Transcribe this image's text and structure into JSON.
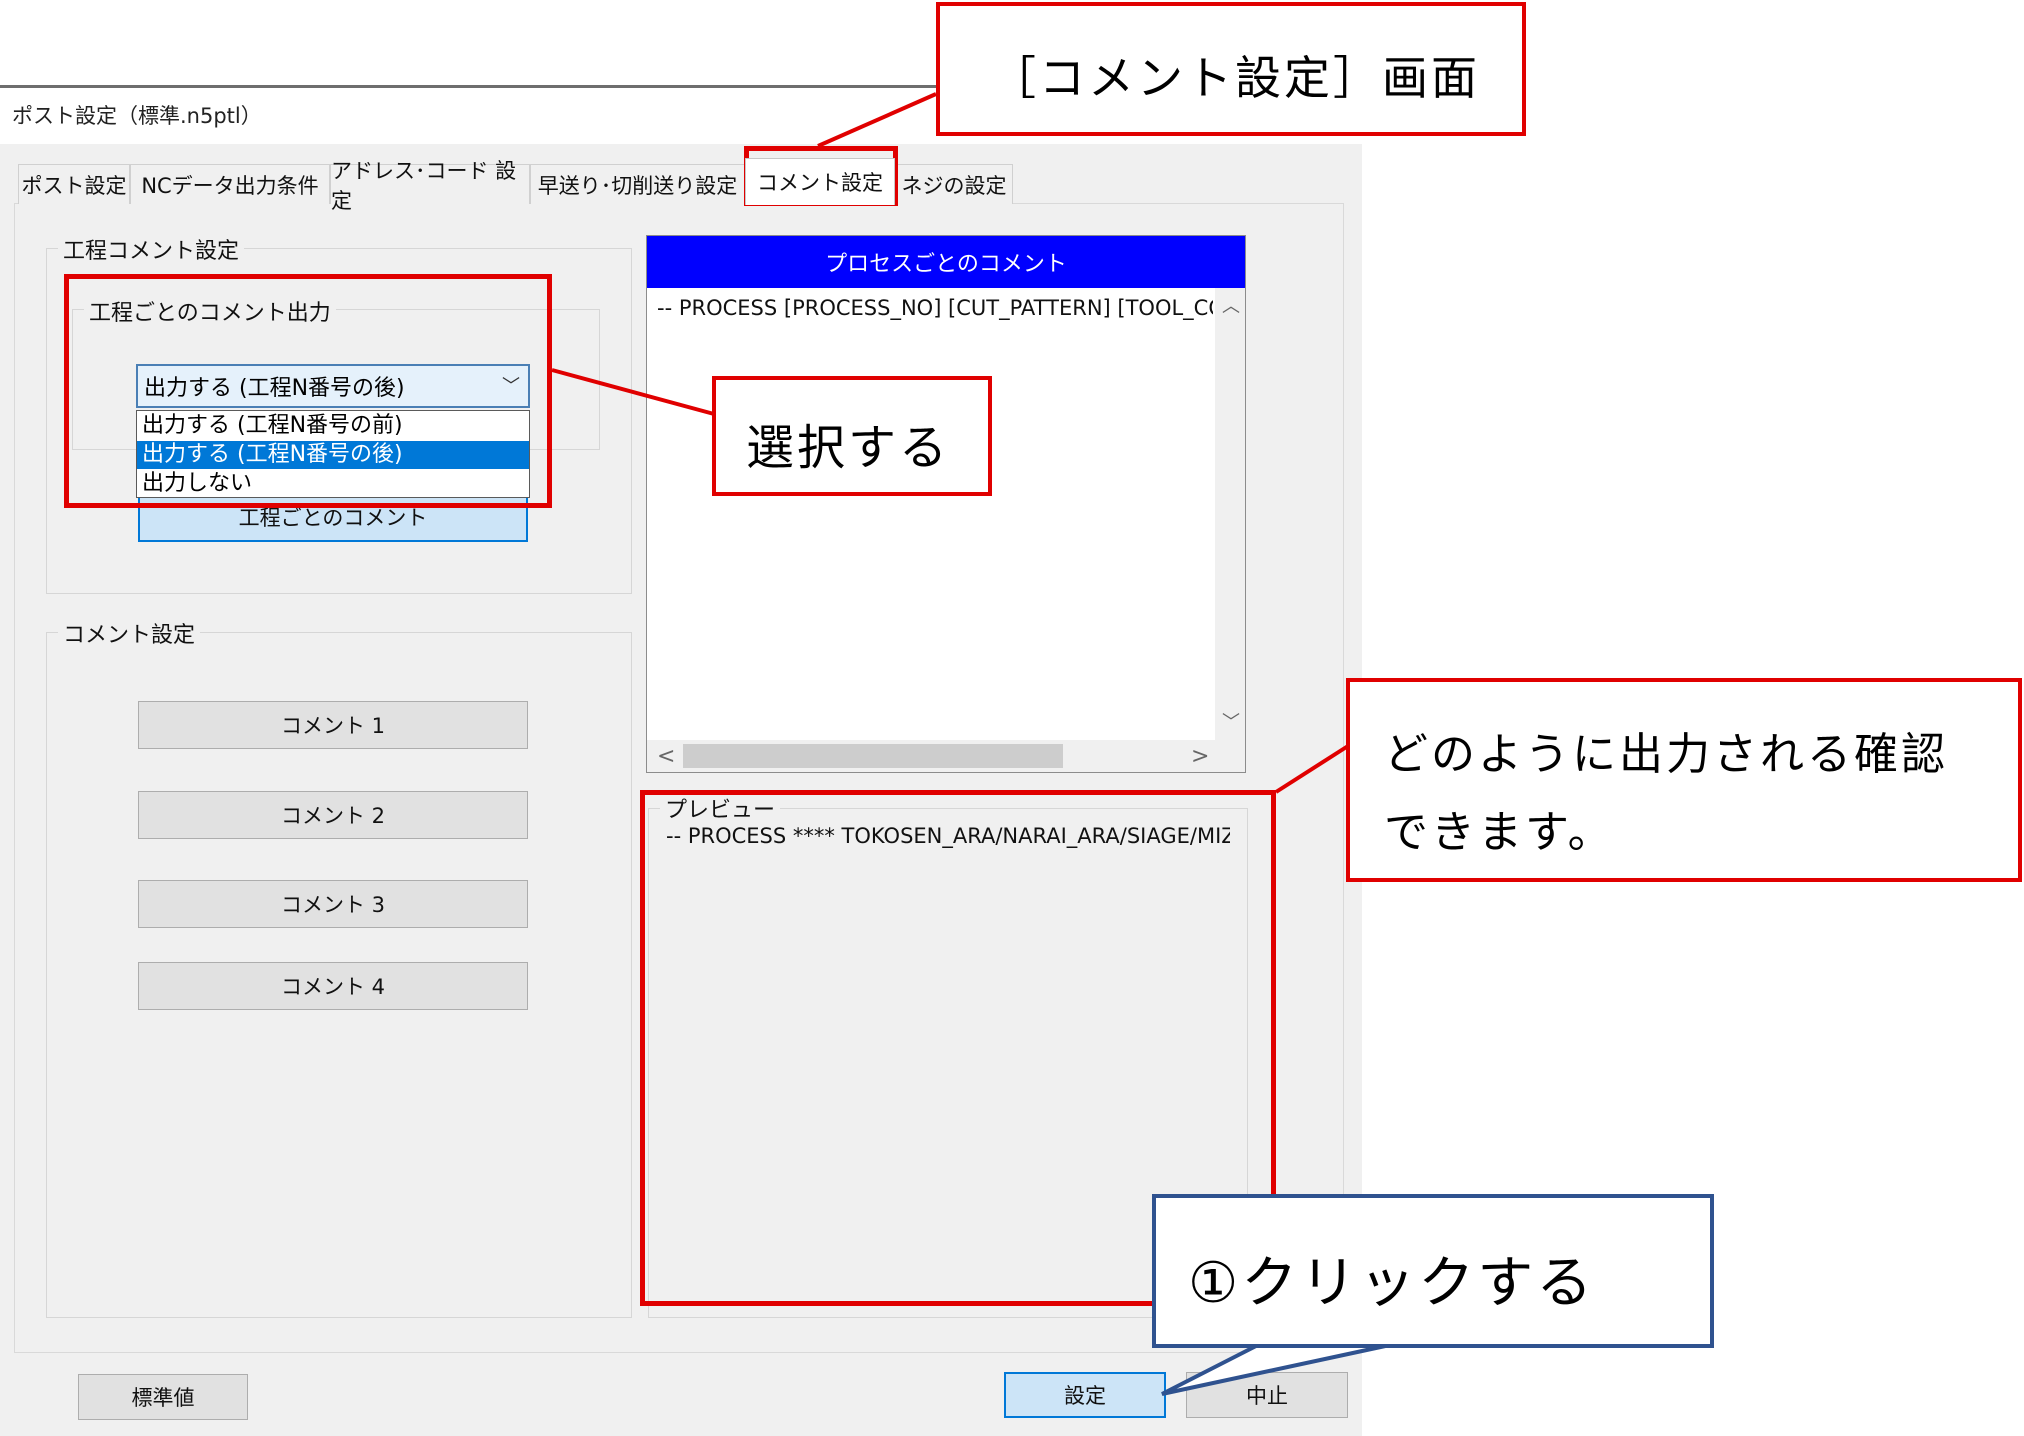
{
  "window": {
    "title": "ポスト設定（標準.n5ptl）"
  },
  "tabs": [
    {
      "label": "ポスト設定"
    },
    {
      "label": "NCデータ出力条件"
    },
    {
      "label": "アドレス･コード 設定"
    },
    {
      "label": "早送り･切削送り設定"
    },
    {
      "label": "コメント設定"
    },
    {
      "label": "ネジの設定"
    }
  ],
  "process_comment_group": {
    "label": "工程コメント設定",
    "sub_label": "工程ごとのコメント出力",
    "combo_value": "出力する (工程N番号の後)",
    "options": [
      "出力する (工程N番号の前)",
      "出力する (工程N番号の後)",
      "出力しない"
    ],
    "button_label": "工程ごとのコメント"
  },
  "comment_group": {
    "label": "コメント設定",
    "buttons": [
      "コメント 1",
      "コメント 2",
      "コメント 3",
      "コメント 4"
    ]
  },
  "process_list": {
    "header": "プロセスごとのコメント",
    "line": "-- PROCESS [PROCESS_NO] [CUT_PATTERN] [TOOL_CO"
  },
  "preview": {
    "label": "プレビュー",
    "line": "-- PROCESS **** TOKOSEN_ARA/NARAI_ARA/SIAGE/MIZ"
  },
  "footer": {
    "default_button": "標準値",
    "ok_button": "設定",
    "cancel_button": "中止"
  },
  "annotations": {
    "screen_name": "［コメント設定］画面",
    "select": "選択する",
    "confirm_line1": "どのように出力される確認",
    "confirm_line2": "できます。",
    "click": "①クリックする"
  },
  "colors": {
    "annotation_red": "#e00000",
    "annotation_blue": "#2f528f",
    "list_header_blue": "#0000ff",
    "selection_blue": "#0078d7"
  }
}
